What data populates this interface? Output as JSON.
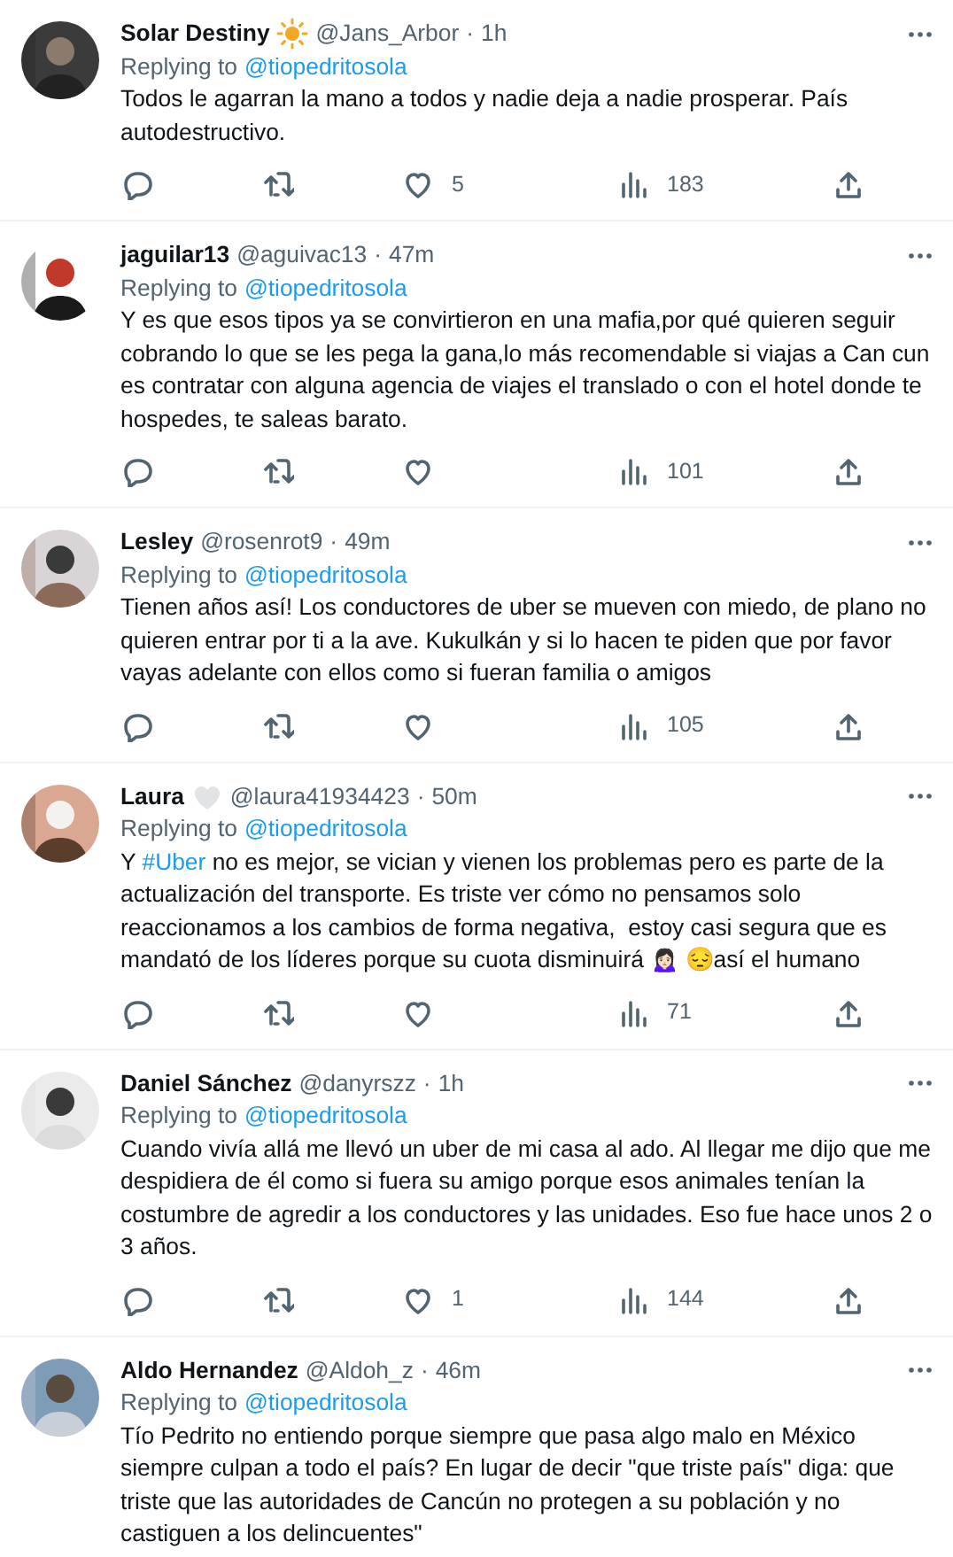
{
  "tweets": [
    {
      "name": "Solar Destiny",
      "badge": {
        "kind": "sun"
      },
      "handle": "@Jans_Arbor",
      "separator": "·",
      "time": "1h",
      "replying_label": "Replying to",
      "replying_to": "@tiopedritosola",
      "body": [
        {
          "kind": "text",
          "text": "Todos le agarran la mano a todos y nadie deja a nadie prosperar. País autodestructivo."
        }
      ],
      "actions": {
        "likes": "5",
        "views": "183"
      }
    },
    {
      "name": "jaguilar13",
      "handle": "@aguivac13",
      "separator": "·",
      "time": "47m",
      "replying_label": "Replying to",
      "replying_to": "@tiopedritosola",
      "body": [
        {
          "kind": "text",
          "text": "Y es que esos tipos ya se convirtieron en una mafia,por qué quieren seguir cobrando lo que se les pega la gana,lo más recomendable si viajas a Can cun es contratar con alguna agencia de viajes el translado o con el hotel donde te hospedes, te saleas barato."
        }
      ],
      "actions": {
        "views": "101"
      }
    },
    {
      "name": "Lesley",
      "handle": "@rosenrot9",
      "separator": "·",
      "time": "49m",
      "replying_label": "Replying to",
      "replying_to": "@tiopedritosola",
      "body": [
        {
          "kind": "text",
          "text": "Tienen años así! Los conductores de uber se mueven con miedo, de plano no quieren entrar por ti a la ave. Kukulkán y si lo hacen te piden que por favor vayas adelante con ellos como si fueran familia o amigos"
        }
      ],
      "actions": {
        "views": "105"
      }
    },
    {
      "name": "Laura",
      "badge": {
        "kind": "heart"
      },
      "handle": "@laura41934423",
      "separator": "·",
      "time": "50m",
      "replying_label": "Replying to",
      "replying_to": "@tiopedritosola",
      "body": [
        {
          "kind": "text",
          "text": "Y "
        },
        {
          "kind": "hashtag",
          "text": "#Uber"
        },
        {
          "kind": "text",
          "text": " no es mejor, se vician y vienen los problemas pero es parte de la actualización del transporte. Es triste ver cómo no pensamos solo reaccionamos a los cambios de forma negativa,  estoy casi segura que es mandató de los líderes porque su cuota disminuirá 🙍🏻‍♀️ 😔así el humano"
        }
      ],
      "actions": {
        "views": "71"
      }
    },
    {
      "name": "Daniel Sánchez",
      "handle": "@danyrszz",
      "separator": "·",
      "time": "1h",
      "replying_label": "Replying to",
      "replying_to": "@tiopedritosola",
      "body": [
        {
          "kind": "text",
          "text": "Cuando vivía allá me llevó un uber de mi casa al ado. Al llegar me dijo que me despidiera de él como si fuera su amigo porque esos animales tenían la costumbre de agredir a los conductores y las unidades. Eso fue hace unos 2 o 3 años."
        }
      ],
      "actions": {
        "likes": "1",
        "views": "144"
      }
    },
    {
      "name": "Aldo Hernandez",
      "handle": "@Aldoh_z",
      "separator": "·",
      "time": "46m",
      "replying_label": "Replying to",
      "replying_to": "@tiopedritosola",
      "body": [
        {
          "kind": "text",
          "text": "Tío Pedrito no entiendo porque siempre que pasa algo malo en México siempre culpan a todo el país? En lugar de decir \"que triste país\" diga: que triste que las autoridades de Cancún no protegen a su población y no castiguen a los delincuentes\""
        }
      ]
    }
  ]
}
